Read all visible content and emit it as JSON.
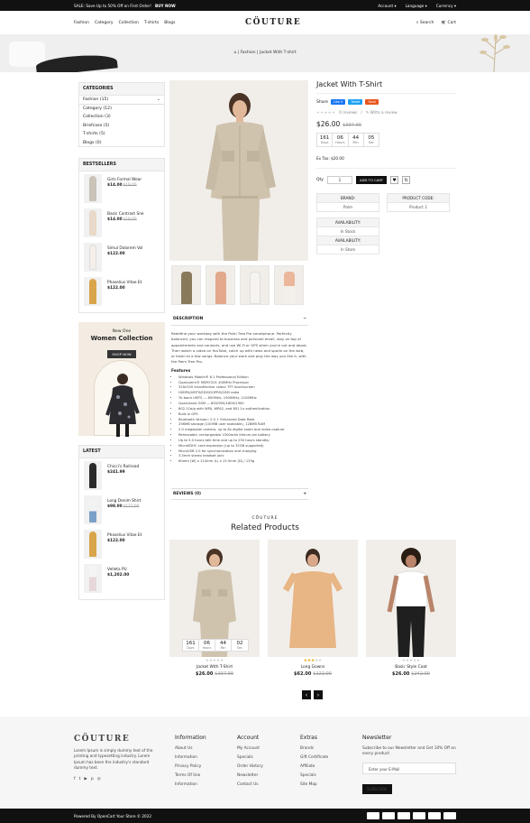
{
  "topbar": {
    "promo": "SALE: Save Up to 50% Off on First Order!",
    "promo_link": "BUY NOW",
    "account": "Account",
    "language": "Language",
    "currency": "Currency"
  },
  "header": {
    "logo": "CÖUTURE",
    "nav": [
      "Fashion",
      "Category",
      "Collection",
      "T-shirts",
      "Blogs"
    ],
    "search": "Search",
    "cart": "Cart"
  },
  "breadcrumb": {
    "items": [
      "Fashion",
      "Jacket With T-shirt"
    ]
  },
  "categories": {
    "title": "CATEGORIES",
    "items": [
      "Fashion (15)",
      "Category (12)",
      "Collection (3)",
      "Briefcase (5)",
      "T-shirts (5)",
      "Blogs (0)"
    ]
  },
  "bestsellers": {
    "title": "BESTSELLERS",
    "items": [
      {
        "name": "Girls Formal Wear",
        "price": "$14.00",
        "old": "$19.00"
      },
      {
        "name": "Basic Contrast Sne",
        "price": "$14.00",
        "old": "$19.00"
      },
      {
        "name": "Simul Dolorem Vol",
        "price": "$122.00",
        "old": ""
      },
      {
        "name": "Phaselius Vitae Et",
        "price": "$122.00",
        "old": ""
      }
    ]
  },
  "ad": {
    "new_one": "New One",
    "title": "Women Collection",
    "button": "SHOP NOW"
  },
  "latest": {
    "title": "LATEST",
    "items": [
      {
        "name": "Chicci's Railroad",
        "price": "$241.99",
        "old": ""
      },
      {
        "name": "Long Denim Shirt",
        "price": "$98.00",
        "old": "$122.00"
      },
      {
        "name": "Phaselius Vitae Et",
        "price": "$122.00",
        "old": ""
      },
      {
        "name": "Velleta PU",
        "price": "$1,202.00",
        "old": ""
      }
    ]
  },
  "product": {
    "title": "Jacket With T-Shirt",
    "share": "Share",
    "share_buttons": [
      "Like 0",
      "Tweet",
      "Save"
    ],
    "reviews": "0 reviews",
    "write_review": "Write a review",
    "price": "$26.00",
    "old_price": "$337.99",
    "countdown": [
      {
        "v": "161",
        "l": "Days"
      },
      {
        "v": "06",
        "l": "Hours"
      },
      {
        "v": "44",
        "l": "Min"
      },
      {
        "v": "05",
        "l": "Sec"
      }
    ],
    "extax": "Ex Tax: $20.00",
    "qty_label": "Qty",
    "qty_value": "1",
    "add_to_cart": "ADD TO CART",
    "brand_label": "BRAND:",
    "brand_value": "Palm",
    "code_label": "PRODUCT CODE:",
    "code_value": "Product 2",
    "avail_label": "AVAILABILITY:",
    "avail_value": "In Stock",
    "avail_label2": "AVAILABILITY:",
    "avail_value2": "In Store"
  },
  "description": {
    "tab": "DESCRIPTION",
    "text": "Redefine your workday with the Palm Treo Pro smartphone. Perfectly balanced, you can respond to business and personal email, stay on top of appointments and contacts, and use Wi-Fi or GPS when you're out and about. Then watch a video on YouTube, catch up with news and sports on the web, or listen to a few songs. Balance your work and play the way you like it, with the Palm Treo Pro.",
    "features_title": "Features",
    "features": [
      "Windows Mobile® 6.1 Professional Edition",
      "Qualcomm® MSM7201 400MHz Processor",
      "320x320 transflective colour TFT touchscreen",
      "HSDPA/UMTS/EDGE/GPRS/GSM radio",
      "Tri-band UMTS — 850MHz, 1900MHz, 2100MHz",
      "Quad-band GSM — 850/900/1800/1900",
      "802.11b/g with WPA, WPA2, and 801.1x authentication",
      "Built-in GPS",
      "Bluetooth Version: 2.0 + Enhanced Data Rate",
      "256MB storage (100MB user available), 128MB RAM",
      "2.0 megapixel camera, up to 8x digital zoom and video capture",
      "Removable, rechargeable 1500mAh lithium-ion battery",
      "Up to 5.0 hours talk time and up to 250 hours standby",
      "MicroSDHC card expansion (up to 32GB supported)",
      "MicroUSB 2.0 for synchronization and charging",
      "3.5mm stereo headset jack",
      "60mm (W) x 114mm (L) x 13.5mm (D) / 133g"
    ],
    "reviews_tab": "REVIEWS (0)"
  },
  "related": {
    "kicker": "CÖUTURE",
    "title": "Related Products",
    "items": [
      {
        "name": "Jacket With T-Shirt",
        "price": "$26.00",
        "old": "$337.99"
      },
      {
        "name": "Long Gowns",
        "price": "$62.00",
        "old": "$122.00"
      },
      {
        "name": "Basic Style Coat",
        "price": "$26.00",
        "old": "$242.00"
      }
    ],
    "countdown": [
      {
        "v": "161",
        "l": "Days"
      },
      {
        "v": "06",
        "l": "Hours"
      },
      {
        "v": "44",
        "l": "Min"
      },
      {
        "v": "02",
        "l": "Sec"
      }
    ]
  },
  "footer": {
    "logo": "CÖUTURE",
    "about": "Lorem Ipsum is simply dummy text of the printing and typesetting industry. Lorem Ipsum has been the industry's standard dummy text.",
    "info_title": "Information",
    "info": [
      "About Us",
      "Information",
      "Privacy Policy",
      "Terms Of Use",
      "Information"
    ],
    "account_title": "Account",
    "account": [
      "My Account",
      "Specials",
      "Order History",
      "Newsletter",
      "Contact Us"
    ],
    "extras_title": "Extras",
    "extras": [
      "Brands",
      "Gift Certificate",
      "Affiliate",
      "Specials",
      "Site Map"
    ],
    "news_title": "Newsletter",
    "news_text": "Subscribe to our Newsletter and Get 10% Off on every product",
    "news_placeholder": "Enter your E-Mail",
    "news_button": "SUBSCRIBE",
    "powered": "Powered By OpenCart Your Store © 2022"
  }
}
